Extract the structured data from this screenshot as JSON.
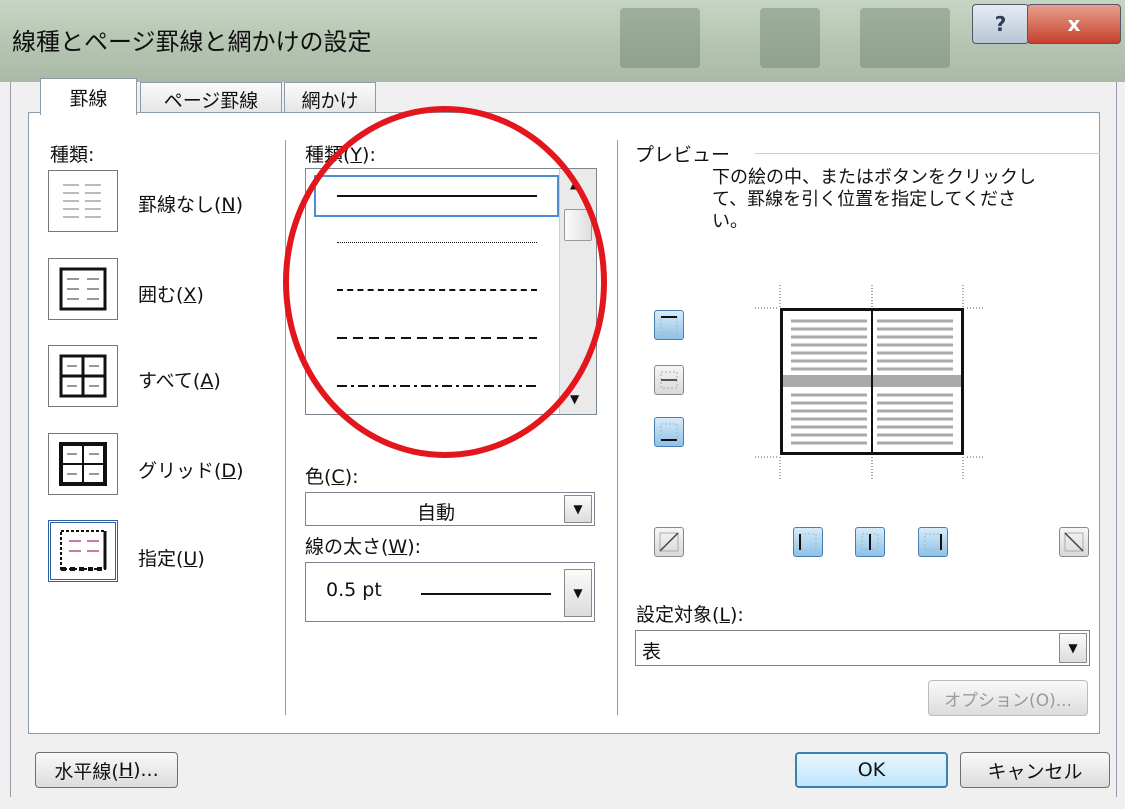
{
  "window": {
    "title": "線種とページ罫線と網かけの設定",
    "help_label": "?",
    "close_label": "x"
  },
  "tabs": [
    {
      "label": "罫線",
      "active": true
    },
    {
      "label": "ページ罫線",
      "active": false
    },
    {
      "label": "網かけ",
      "active": false
    }
  ],
  "setting": {
    "heading": "種類:",
    "items": [
      {
        "pre": "罫線なし(",
        "key": "N",
        "post": ")",
        "icon": "border-none-icon"
      },
      {
        "pre": "囲む(",
        "key": "X",
        "post": ")",
        "icon": "border-box-icon"
      },
      {
        "pre": "すべて(",
        "key": "A",
        "post": ")",
        "icon": "border-all-icon"
      },
      {
        "pre": "グリッド(",
        "key": "D",
        "post": ")",
        "icon": "border-grid-icon"
      },
      {
        "pre": "指定(",
        "key": "U",
        "post": ")",
        "icon": "border-custom-icon",
        "selected": true
      }
    ]
  },
  "style": {
    "heading_pre": "種類(",
    "heading_key": "Y",
    "heading_post": "):",
    "line_styles": [
      "solid",
      "dotted",
      "dashed-short",
      "dashed-long",
      "dash-dot"
    ],
    "selected_index": 0
  },
  "color": {
    "label_pre": "色(",
    "label_key": "C",
    "label_post": "):",
    "value": "自動"
  },
  "width": {
    "label_pre": "線の太さ(",
    "label_key": "W",
    "label_post": "):",
    "value": "0.5 pt"
  },
  "preview": {
    "heading": "プレビュー",
    "instruction": "下の絵の中、またはボタンをクリックして、罫線を引く位置を指定してください。"
  },
  "apply_to": {
    "label_pre": "設定対象(",
    "label_key": "L",
    "label_post": "):",
    "value": "表"
  },
  "buttons": {
    "options": "オプション(O)...",
    "horizontal_line_pre": "水平線(",
    "horizontal_line_key": "H",
    "horizontal_line_post": ")...",
    "ok": "OK",
    "cancel": "キャンセル"
  },
  "colors": {
    "annotation_circle": "#e3151d",
    "button_blue": "#8fc1e6"
  }
}
